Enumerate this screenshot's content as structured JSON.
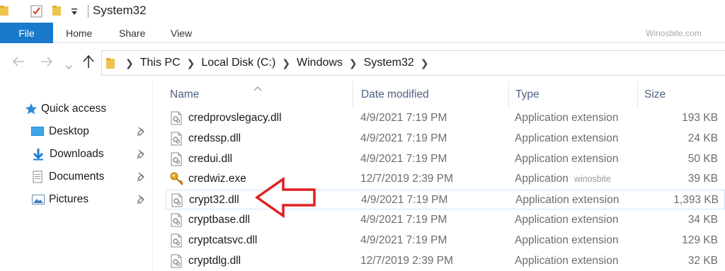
{
  "window": {
    "title": "System32",
    "quick_access_toolbar": [
      "folder-icon",
      "properties-check-icon",
      "new-folder-icon",
      "customize-dropdown-icon"
    ]
  },
  "ribbon": {
    "file_label": "File",
    "tabs": [
      "Home",
      "Share",
      "View"
    ],
    "watermark": "Winosbite.com",
    "accent_color": "#1979ca"
  },
  "nav": {
    "back": "back-arrow-icon",
    "forward": "forward-arrow-icon",
    "recent": "recent-locations-chevron-icon",
    "up": "up-arrow-icon"
  },
  "breadcrumb": [
    "This PC",
    "Local Disk (C:)",
    "Windows",
    "System32"
  ],
  "sidebar": {
    "quick_access": "Quick access",
    "items": [
      {
        "label": "Desktop",
        "icon": "desktop-folder-icon",
        "pinned": true
      },
      {
        "label": "Downloads",
        "icon": "downloads-arrow-icon",
        "pinned": true
      },
      {
        "label": "Documents",
        "icon": "documents-icon",
        "pinned": true
      },
      {
        "label": "Pictures",
        "icon": "pictures-icon",
        "pinned": true
      }
    ]
  },
  "columns": {
    "name": "Name",
    "date": "Date modified",
    "type": "Type",
    "size": "Size"
  },
  "files": [
    {
      "name": "credprovslegacy.dll",
      "date": "4/9/2021 7:19 PM",
      "type": "Application extension",
      "type_note": "",
      "size": "193 KB",
      "icon": "dll-file-icon"
    },
    {
      "name": "credssp.dll",
      "date": "4/9/2021 7:19 PM",
      "type": "Application extension",
      "type_note": "",
      "size": "24 KB",
      "icon": "dll-file-icon"
    },
    {
      "name": "credui.dll",
      "date": "4/9/2021 7:19 PM",
      "type": "Application extension",
      "type_note": "",
      "size": "50 KB",
      "icon": "dll-file-icon"
    },
    {
      "name": "credwiz.exe",
      "date": "12/7/2019 2:39 PM",
      "type": "Application",
      "type_note": "winosbite",
      "size": "39 KB",
      "icon": "key-exe-icon"
    },
    {
      "name": "crypt32.dll",
      "date": "4/9/2021 7:19 PM",
      "type": "Application extension",
      "type_note": "",
      "size": "1,393 KB",
      "icon": "dll-file-icon",
      "highlighted": true
    },
    {
      "name": "cryptbase.dll",
      "date": "4/9/2021 7:19 PM",
      "type": "Application extension",
      "type_note": "",
      "size": "34 KB",
      "icon": "dll-file-icon"
    },
    {
      "name": "cryptcatsvc.dll",
      "date": "4/9/2021 7:19 PM",
      "type": "Application extension",
      "type_note": "",
      "size": "129 KB",
      "icon": "dll-file-icon"
    },
    {
      "name": "cryptdlg.dll",
      "date": "12/7/2019 2:39 PM",
      "type": "Application extension",
      "type_note": "",
      "size": "32 KB",
      "icon": "dll-file-icon"
    }
  ],
  "annotation": {
    "color": "#e02020",
    "icon": "red-arrow-pointing-left-icon"
  }
}
